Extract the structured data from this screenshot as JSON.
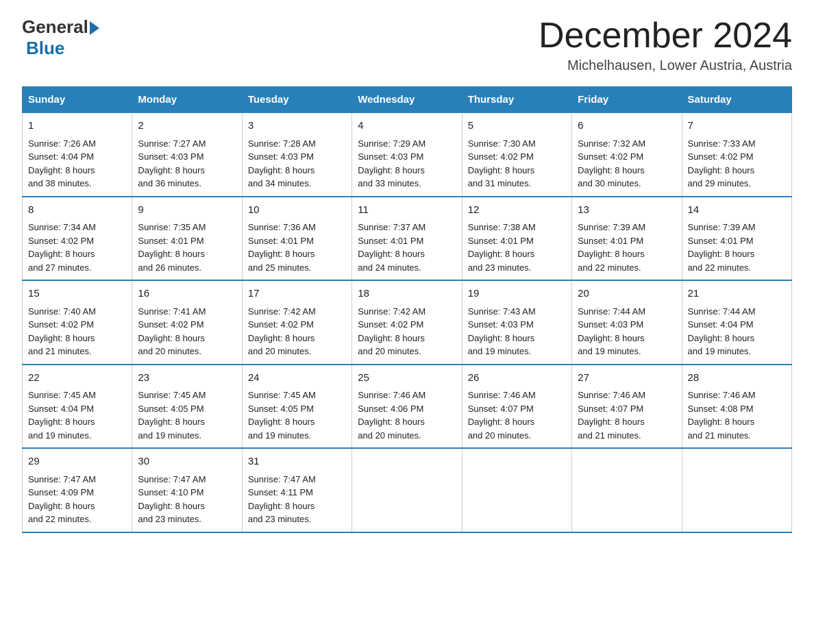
{
  "logo": {
    "text_general": "General",
    "text_blue": "Blue"
  },
  "title": "December 2024",
  "subtitle": "Michelhausen, Lower Austria, Austria",
  "weekdays": [
    "Sunday",
    "Monday",
    "Tuesday",
    "Wednesday",
    "Thursday",
    "Friday",
    "Saturday"
  ],
  "weeks": [
    [
      {
        "day": "1",
        "sunrise": "7:26 AM",
        "sunset": "4:04 PM",
        "daylight": "8 hours and 38 minutes."
      },
      {
        "day": "2",
        "sunrise": "7:27 AM",
        "sunset": "4:03 PM",
        "daylight": "8 hours and 36 minutes."
      },
      {
        "day": "3",
        "sunrise": "7:28 AM",
        "sunset": "4:03 PM",
        "daylight": "8 hours and 34 minutes."
      },
      {
        "day": "4",
        "sunrise": "7:29 AM",
        "sunset": "4:03 PM",
        "daylight": "8 hours and 33 minutes."
      },
      {
        "day": "5",
        "sunrise": "7:30 AM",
        "sunset": "4:02 PM",
        "daylight": "8 hours and 31 minutes."
      },
      {
        "day": "6",
        "sunrise": "7:32 AM",
        "sunset": "4:02 PM",
        "daylight": "8 hours and 30 minutes."
      },
      {
        "day": "7",
        "sunrise": "7:33 AM",
        "sunset": "4:02 PM",
        "daylight": "8 hours and 29 minutes."
      }
    ],
    [
      {
        "day": "8",
        "sunrise": "7:34 AM",
        "sunset": "4:02 PM",
        "daylight": "8 hours and 27 minutes."
      },
      {
        "day": "9",
        "sunrise": "7:35 AM",
        "sunset": "4:01 PM",
        "daylight": "8 hours and 26 minutes."
      },
      {
        "day": "10",
        "sunrise": "7:36 AM",
        "sunset": "4:01 PM",
        "daylight": "8 hours and 25 minutes."
      },
      {
        "day": "11",
        "sunrise": "7:37 AM",
        "sunset": "4:01 PM",
        "daylight": "8 hours and 24 minutes."
      },
      {
        "day": "12",
        "sunrise": "7:38 AM",
        "sunset": "4:01 PM",
        "daylight": "8 hours and 23 minutes."
      },
      {
        "day": "13",
        "sunrise": "7:39 AM",
        "sunset": "4:01 PM",
        "daylight": "8 hours and 22 minutes."
      },
      {
        "day": "14",
        "sunrise": "7:39 AM",
        "sunset": "4:01 PM",
        "daylight": "8 hours and 22 minutes."
      }
    ],
    [
      {
        "day": "15",
        "sunrise": "7:40 AM",
        "sunset": "4:02 PM",
        "daylight": "8 hours and 21 minutes."
      },
      {
        "day": "16",
        "sunrise": "7:41 AM",
        "sunset": "4:02 PM",
        "daylight": "8 hours and 20 minutes."
      },
      {
        "day": "17",
        "sunrise": "7:42 AM",
        "sunset": "4:02 PM",
        "daylight": "8 hours and 20 minutes."
      },
      {
        "day": "18",
        "sunrise": "7:42 AM",
        "sunset": "4:02 PM",
        "daylight": "8 hours and 20 minutes."
      },
      {
        "day": "19",
        "sunrise": "7:43 AM",
        "sunset": "4:03 PM",
        "daylight": "8 hours and 19 minutes."
      },
      {
        "day": "20",
        "sunrise": "7:44 AM",
        "sunset": "4:03 PM",
        "daylight": "8 hours and 19 minutes."
      },
      {
        "day": "21",
        "sunrise": "7:44 AM",
        "sunset": "4:04 PM",
        "daylight": "8 hours and 19 minutes."
      }
    ],
    [
      {
        "day": "22",
        "sunrise": "7:45 AM",
        "sunset": "4:04 PM",
        "daylight": "8 hours and 19 minutes."
      },
      {
        "day": "23",
        "sunrise": "7:45 AM",
        "sunset": "4:05 PM",
        "daylight": "8 hours and 19 minutes."
      },
      {
        "day": "24",
        "sunrise": "7:45 AM",
        "sunset": "4:05 PM",
        "daylight": "8 hours and 19 minutes."
      },
      {
        "day": "25",
        "sunrise": "7:46 AM",
        "sunset": "4:06 PM",
        "daylight": "8 hours and 20 minutes."
      },
      {
        "day": "26",
        "sunrise": "7:46 AM",
        "sunset": "4:07 PM",
        "daylight": "8 hours and 20 minutes."
      },
      {
        "day": "27",
        "sunrise": "7:46 AM",
        "sunset": "4:07 PM",
        "daylight": "8 hours and 21 minutes."
      },
      {
        "day": "28",
        "sunrise": "7:46 AM",
        "sunset": "4:08 PM",
        "daylight": "8 hours and 21 minutes."
      }
    ],
    [
      {
        "day": "29",
        "sunrise": "7:47 AM",
        "sunset": "4:09 PM",
        "daylight": "8 hours and 22 minutes."
      },
      {
        "day": "30",
        "sunrise": "7:47 AM",
        "sunset": "4:10 PM",
        "daylight": "8 hours and 23 minutes."
      },
      {
        "day": "31",
        "sunrise": "7:47 AM",
        "sunset": "4:11 PM",
        "daylight": "8 hours and 23 minutes."
      },
      null,
      null,
      null,
      null
    ]
  ],
  "labels": {
    "sunrise": "Sunrise:",
    "sunset": "Sunset:",
    "daylight": "Daylight:"
  }
}
